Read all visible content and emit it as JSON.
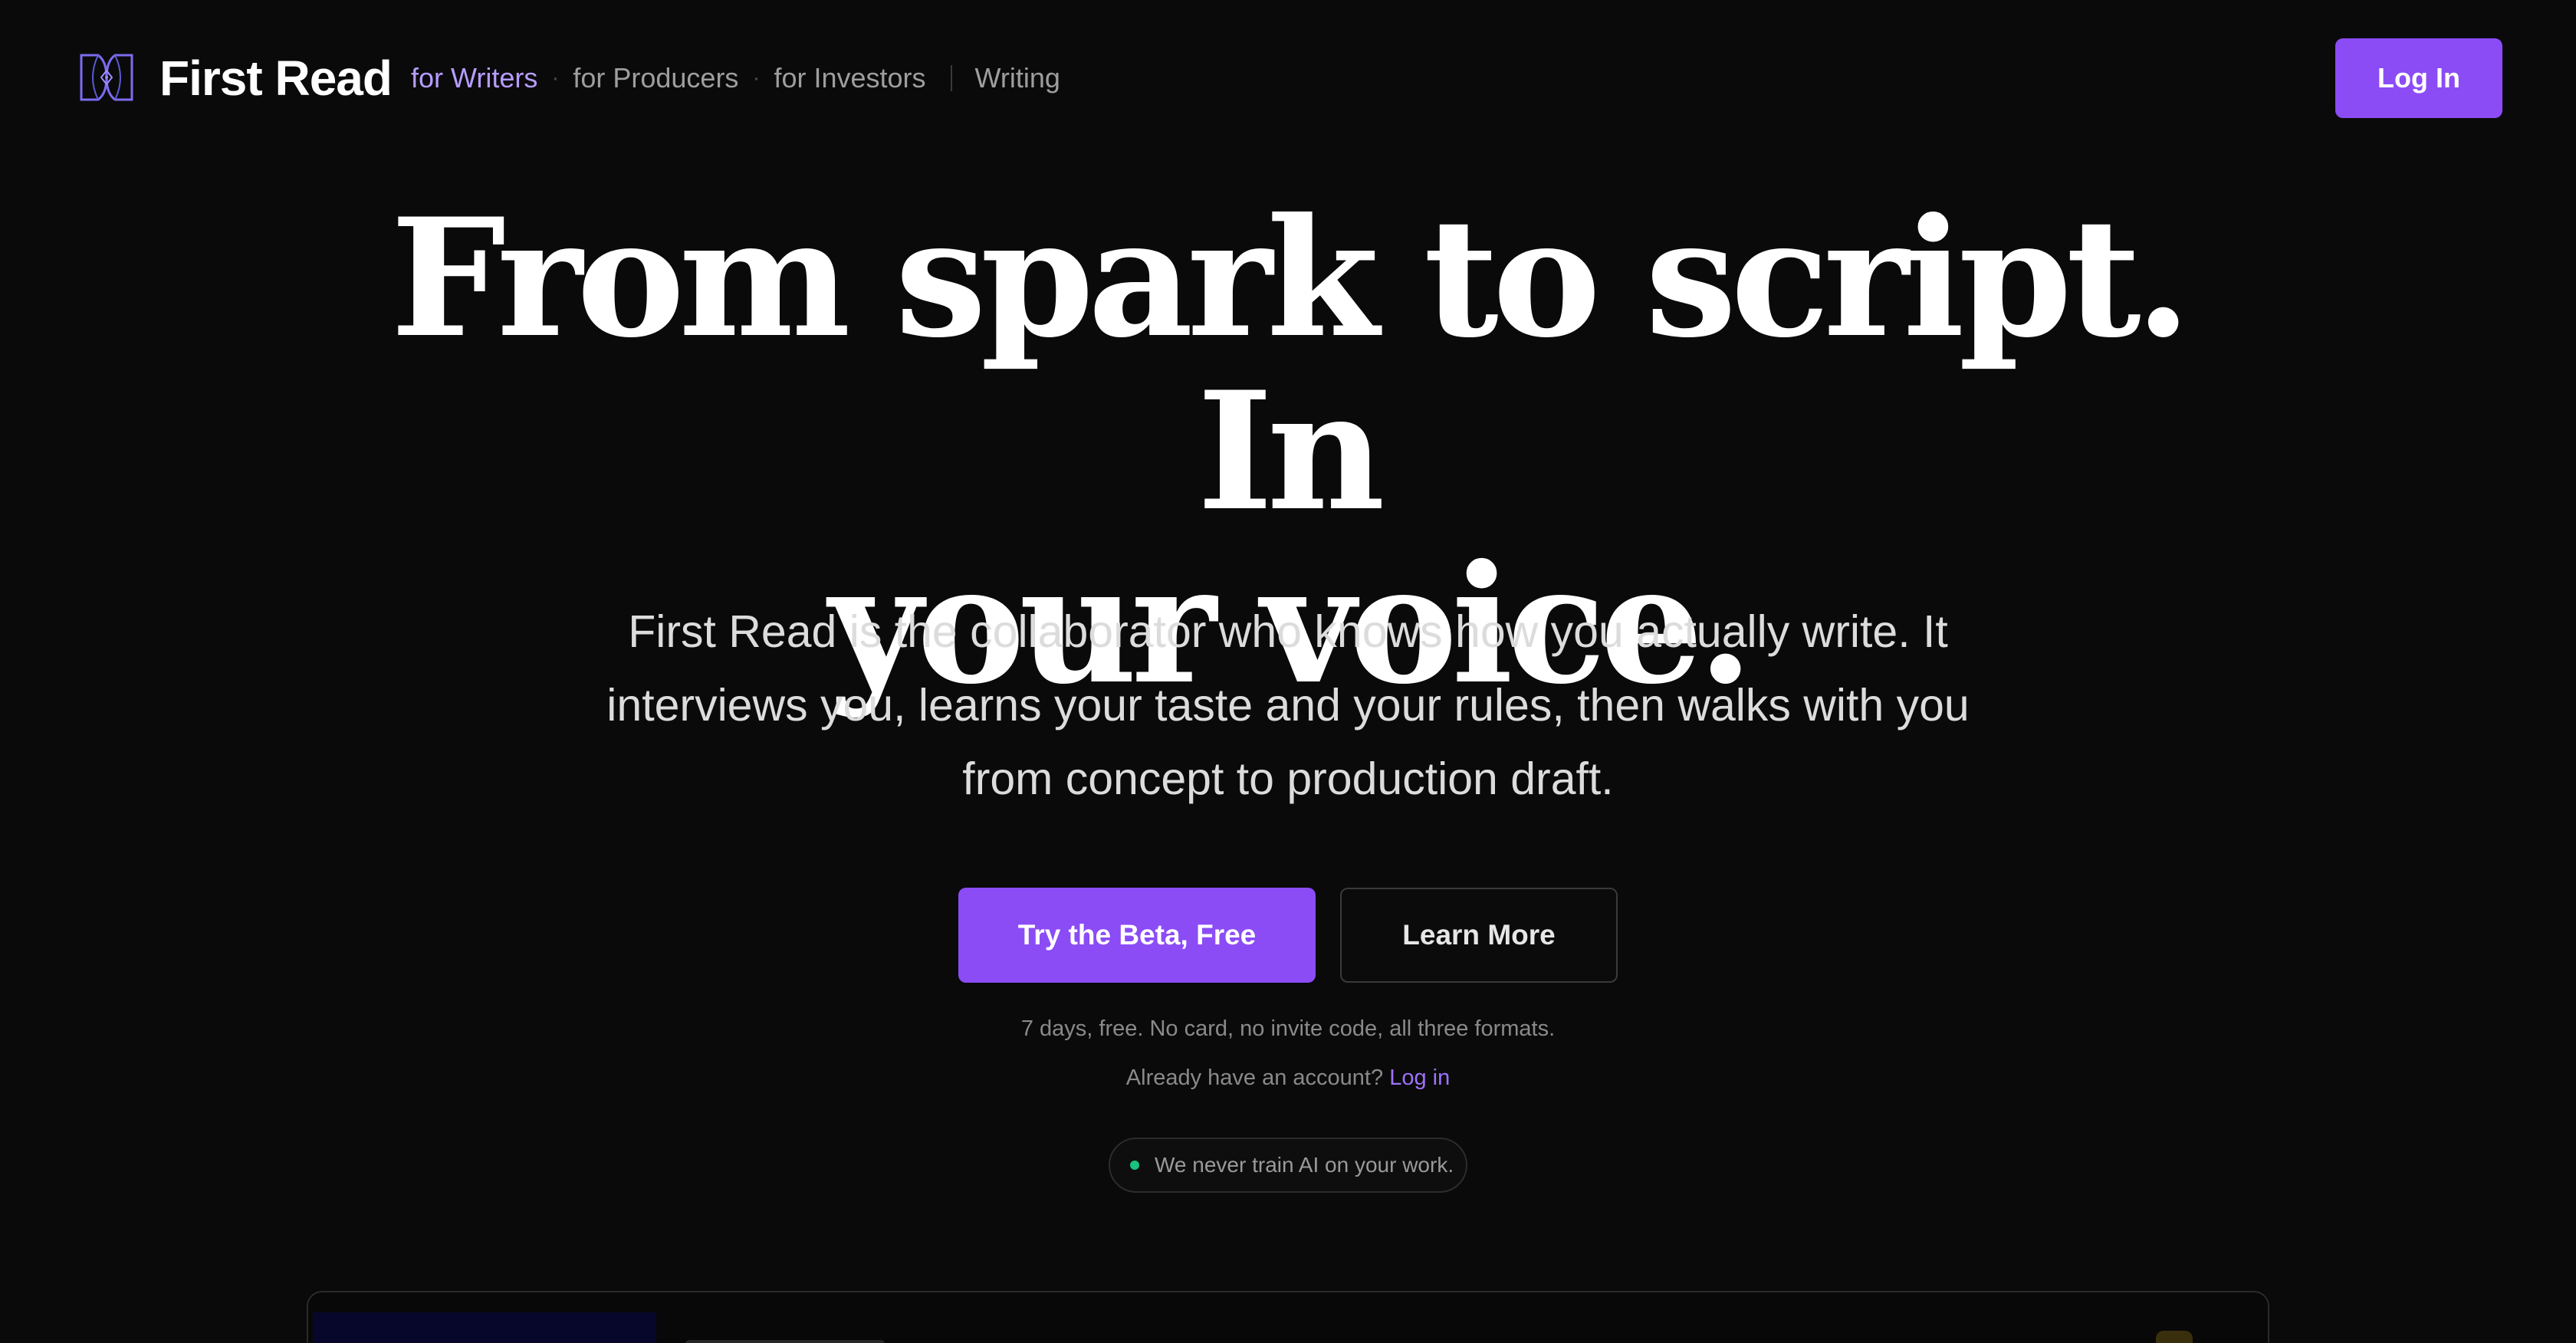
{
  "brand": {
    "name": "First Read",
    "accent_color": "#8b4cf6",
    "background_color": "#0a0a0a"
  },
  "nav": {
    "links": [
      {
        "label": "for Writers",
        "active": true
      },
      {
        "label": "for Producers",
        "active": false
      },
      {
        "label": "for Investors",
        "active": false
      },
      {
        "label": "Writing",
        "active": false
      }
    ],
    "login_label": "Log In"
  },
  "hero": {
    "title_line1": "From spark to script. In",
    "title_line2": "your voice.",
    "subtitle": "First Read is the collaborator who knows how you actually write. It interviews you, learns your taste and your rules, then walks with you from concept to production draft.",
    "primary_cta": "Try the Beta, Free",
    "secondary_cta": "Learn More",
    "note_trial": "7 days, free. No card, no invite code, all three formats.",
    "note_account_prefix": "Already have an account?",
    "note_account_link": "Log in",
    "badge_text": "We never train AI on your work.",
    "badge_dot_color": "#19c37d"
  }
}
